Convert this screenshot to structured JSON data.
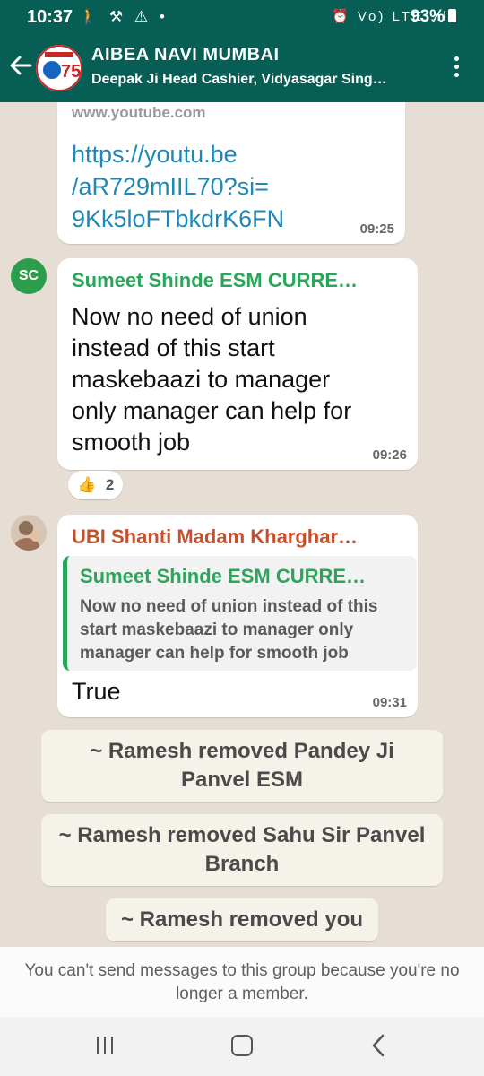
{
  "status_bar": {
    "time": "10:37",
    "battery": "93%",
    "left_icons": "🚶 ⚒ ⚠ •",
    "right_icons": "⏰ Vo) LTE .ıl"
  },
  "header": {
    "title": "AIBEA NAVI MUMBAI",
    "subtitle": "Deepak Ji Head Cashier, Vidyasagar Sing…",
    "avatar_label": "AIBEA 75"
  },
  "messages": [
    {
      "type": "link",
      "partial_top": "www.youtube.com",
      "lines": [
        "https://youtu.be",
        "/aR729mIIL70?si=",
        "9Kk5loFTbkdrK6FN"
      ],
      "time": "09:25"
    },
    {
      "type": "text",
      "avatar_initials": "SC",
      "sender": "Sumeet Shinde ESM CURRE…",
      "sender_color": "#2aa65a",
      "lines": [
        "Now no need of union",
        "instead of this start",
        "maskebaazi to manager",
        "only manager can help for",
        "smooth job"
      ],
      "time": "09:26",
      "reaction_emoji": "👍",
      "reaction_count": "2"
    },
    {
      "type": "reply",
      "sender": "UBI Shanti Madam Kharghar…",
      "sender_color": "#c6502b",
      "quote_sender": "Sumeet Shinde ESM CURRE…",
      "quote_lines": [
        "Now no need of union instead of this",
        "start maskebaazi to manager only",
        "manager can help for smooth job"
      ],
      "text": "True",
      "time": "09:31"
    }
  ],
  "system_messages": [
    {
      "lines": [
        "~ Ramesh removed Pandey Ji",
        "Panvel ESM"
      ]
    },
    {
      "lines": [
        "~ Ramesh removed Sahu Sir Panvel",
        "Branch"
      ]
    },
    {
      "lines": [
        "~ Ramesh removed you"
      ]
    }
  ],
  "footer": {
    "notice": "You can't send messages to this group because you're no longer a member."
  },
  "colors": {
    "header_bg": "#075e54",
    "chat_bg": "#e6ded4",
    "link": "#1e88b6"
  }
}
